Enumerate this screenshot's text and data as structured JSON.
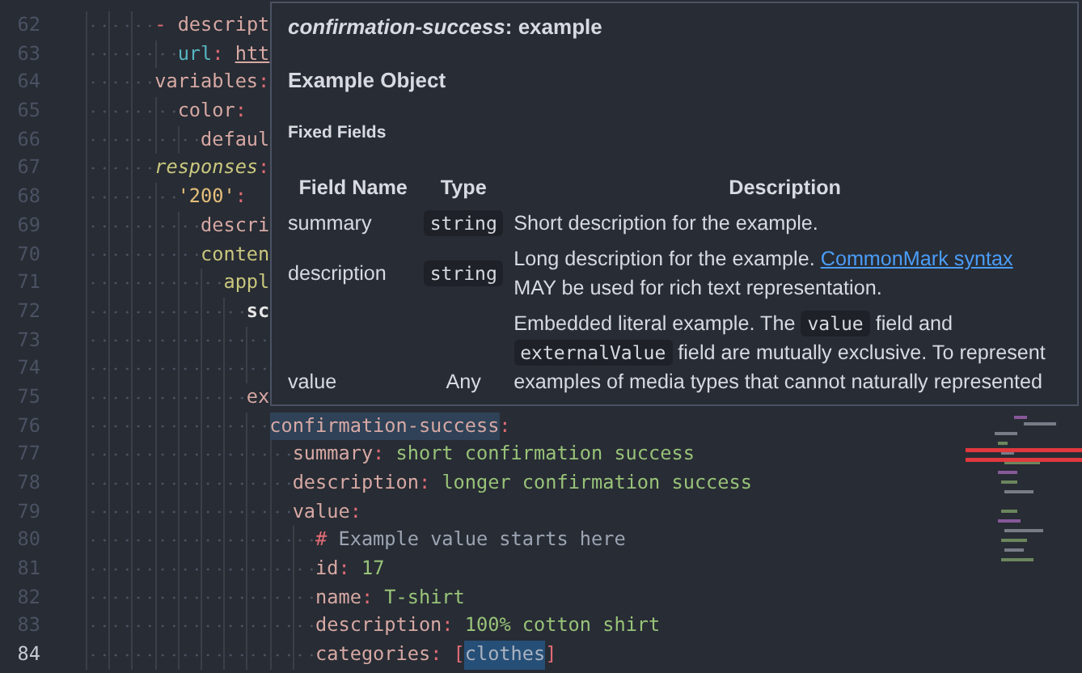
{
  "editor": {
    "lines": [
      {
        "number": "62",
        "current": false,
        "tokens": [
          {
            "kind": "punct",
            "text": "- "
          },
          {
            "kind": "key",
            "text": "descript"
          }
        ],
        "children": [
          {
            "number": "63",
            "current": false,
            "tokens": [
              {
                "kind": "property",
                "text": "url"
              },
              {
                "kind": "punct",
                "text": ": "
              },
              {
                "kind": "link",
                "text": "htt"
              }
            ]
          }
        ]
      },
      {
        "number": "64",
        "current": false,
        "tokens": [
          {
            "kind": "key",
            "text": "variables"
          },
          {
            "kind": "punct",
            "text": ":"
          }
        ],
        "children": [
          {
            "number": "65",
            "current": false,
            "tokens": [
              {
                "kind": "key",
                "text": "color"
              },
              {
                "kind": "punct",
                "text": ":"
              }
            ],
            "children": [
              {
                "number": "66",
                "current": false,
                "tokens": [
                  {
                    "kind": "key",
                    "text": "defaul"
                  }
                ]
              }
            ]
          }
        ]
      },
      {
        "number": "67",
        "current": false,
        "tokens": [
          {
            "kind": "keyword",
            "text": "responses"
          },
          {
            "kind": "punct",
            "text": ":"
          }
        ],
        "children": [
          {
            "number": "68",
            "current": false,
            "tokens": [
              {
                "kind": "quoted",
                "text": "'200'"
              },
              {
                "kind": "punct",
                "text": ":"
              }
            ],
            "children": [
              {
                "number": "69",
                "current": false,
                "tokens": [
                  {
                    "kind": "key",
                    "text": "descri"
                  }
                ]
              },
              {
                "number": "70",
                "current": false,
                "tokens": [
                  {
                    "kind": "section",
                    "text": "conten"
                  }
                ],
                "children": [
                  {
                    "number": "71",
                    "current": false,
                    "tokens": [
                      {
                        "kind": "section",
                        "text": "appl"
                      }
                    ],
                    "children": [
                      {
                        "number": "72",
                        "current": false,
                        "tokens": [
                          {
                            "kind": "strong",
                            "text": "sc"
                          }
                        ],
                        "children": [
                          {
                            "number": "73",
                            "current": false
                          },
                          {
                            "number": "74",
                            "current": false
                          }
                        ]
                      },
                      {
                        "number": "75",
                        "current": false,
                        "tokens": [
                          {
                            "kind": "key",
                            "text": "ex"
                          }
                        ],
                        "children": [
                          {
                            "number": "76",
                            "current": false,
                            "tokens": [
                              {
                                "kind": "key",
                                "text": "confirmation-success",
                                "highlighted": true
                              },
                              {
                                "kind": "punct",
                                "text": ":"
                              }
                            ],
                            "children": [
                              {
                                "number": "77",
                                "current": false,
                                "tokens": [
                                  {
                                    "kind": "key",
                                    "text": "summary"
                                  },
                                  {
                                    "kind": "punct",
                                    "text": ": "
                                  },
                                  {
                                    "kind": "string",
                                    "text": "short confirmation success"
                                  }
                                ]
                              },
                              {
                                "number": "78",
                                "current": false,
                                "tokens": [
                                  {
                                    "kind": "key",
                                    "text": "description"
                                  },
                                  {
                                    "kind": "punct",
                                    "text": ": "
                                  },
                                  {
                                    "kind": "string",
                                    "text": "longer confirmation success"
                                  }
                                ]
                              },
                              {
                                "number": "79",
                                "current": false,
                                "tokens": [
                                  {
                                    "kind": "key",
                                    "text": "value"
                                  },
                                  {
                                    "kind": "punct",
                                    "text": ":"
                                  }
                                ],
                                "children": [
                                  {
                                    "number": "80",
                                    "current": false,
                                    "tokens": [
                                      {
                                        "kind": "punct",
                                        "text": "# "
                                      },
                                      {
                                        "kind": "comment",
                                        "text": "Example value starts here"
                                      }
                                    ]
                                  },
                                  {
                                    "number": "81",
                                    "current": false,
                                    "tokens": [
                                      {
                                        "kind": "key",
                                        "text": "id"
                                      },
                                      {
                                        "kind": "punct",
                                        "text": ": "
                                      },
                                      {
                                        "kind": "string",
                                        "text": "17"
                                      }
                                    ]
                                  },
                                  {
                                    "number": "82",
                                    "current": false,
                                    "tokens": [
                                      {
                                        "kind": "key",
                                        "text": "name"
                                      },
                                      {
                                        "kind": "punct",
                                        "text": ": "
                                      },
                                      {
                                        "kind": "string",
                                        "text": "T-shirt"
                                      }
                                    ]
                                  },
                                  {
                                    "number": "83",
                                    "current": false,
                                    "tokens": [
                                      {
                                        "kind": "key",
                                        "text": "description"
                                      },
                                      {
                                        "kind": "punct",
                                        "text": ": "
                                      },
                                      {
                                        "kind": "string",
                                        "text": "100% cotton shirt"
                                      }
                                    ]
                                  },
                                  {
                                    "number": "84",
                                    "current": true,
                                    "tokens": [
                                      {
                                        "kind": "key",
                                        "text": "categories"
                                      },
                                      {
                                        "kind": "punct",
                                        "text": ": ["
                                      },
                                      {
                                        "kind": "plain",
                                        "text": "clothes",
                                        "highlighted": true
                                      },
                                      {
                                        "kind": "punct",
                                        "text": "]"
                                      }
                                    ]
                                  }
                                ]
                              }
                            ]
                          }
                        ]
                      }
                    ]
                  }
                ]
              }
            ]
          }
        ]
      }
    ]
  },
  "hover": {
    "title": "*confirmation-success*: example",
    "heading": "Example Object",
    "subheading": "Fixed Fields",
    "columns": [
      "Field Name",
      "Type",
      "Description"
    ],
    "rows": [
      {
        "name": "summary",
        "type": "string",
        "type_is_code": true,
        "description": [
          {
            "kind": "text",
            "text": "Short description for the example."
          }
        ]
      },
      {
        "name": "description",
        "type": "string",
        "type_is_code": true,
        "description": [
          {
            "kind": "text",
            "text": "Long description for the example. "
          },
          {
            "kind": "link",
            "text": "CommonMark syntax"
          },
          {
            "kind": "text",
            "text": " MAY be used for rich text representation."
          }
        ]
      },
      {
        "name": "value",
        "type": "Any",
        "type_is_code": false,
        "description": [
          {
            "kind": "text",
            "text": "Embedded literal example. The "
          },
          {
            "kind": "code",
            "text": "value"
          },
          {
            "kind": "text",
            "text": " field and "
          },
          {
            "kind": "code",
            "text": "externalValue"
          },
          {
            "kind": "text",
            "text": " field are mutually exclusive. To represent examples of media types that cannot naturally represented"
          }
        ]
      }
    ]
  }
}
